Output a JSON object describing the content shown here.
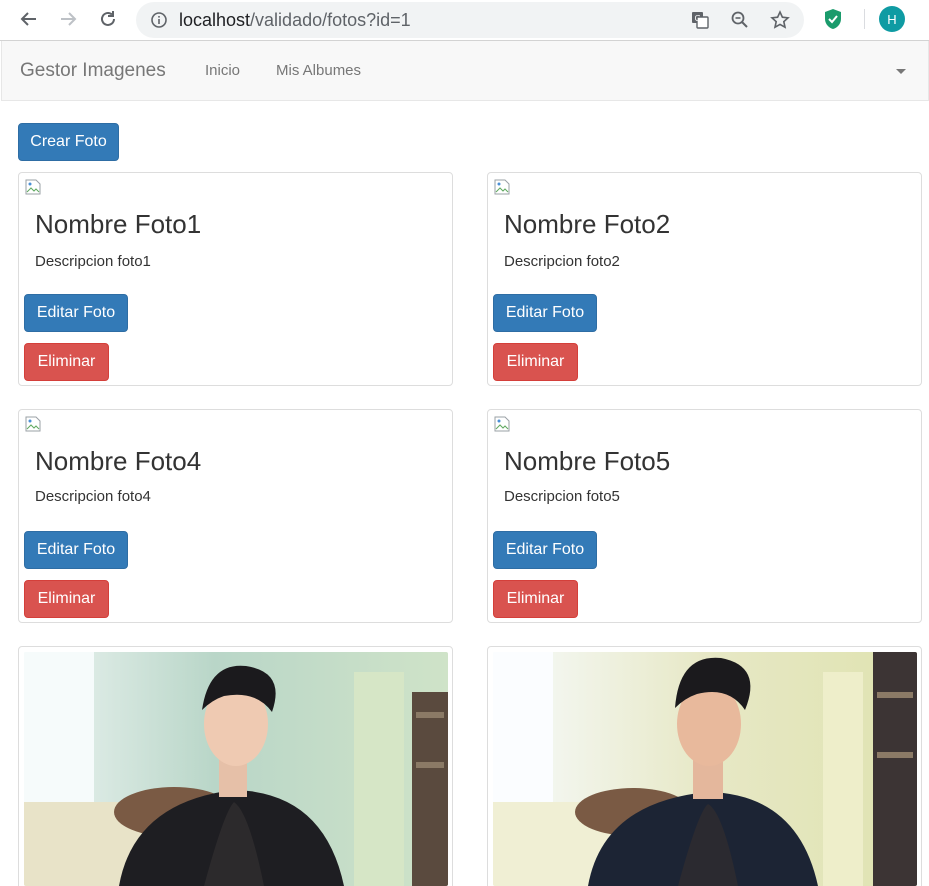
{
  "browser": {
    "url_host": "localhost",
    "url_path": "/validado/fotos?id=1",
    "profile_initial": "H"
  },
  "navbar": {
    "brand": "Gestor Imagenes",
    "links": [
      "Inicio",
      "Mis Albumes"
    ]
  },
  "actions": {
    "create_label": "Crear Foto"
  },
  "cards": [
    {
      "title": "Nombre Foto1",
      "description": "Descripcion foto1",
      "edit_label": "Editar Foto",
      "delete_label": "Eliminar"
    },
    {
      "title": "Nombre Foto2",
      "description": "Descripcion foto2",
      "edit_label": "Editar Foto",
      "delete_label": "Eliminar"
    },
    {
      "title": "Nombre Foto4",
      "description": "Descripcion foto4",
      "edit_label": "Editar Foto",
      "delete_label": "Eliminar"
    },
    {
      "title": "Nombre Foto5",
      "description": "Descripcion foto5",
      "edit_label": "Editar Foto",
      "delete_label": "Eliminar"
    }
  ],
  "colors": {
    "primary": "#337ab7",
    "danger": "#d9534f",
    "navbar_bg": "#f8f8f8",
    "profile": "#0f9ba3"
  }
}
